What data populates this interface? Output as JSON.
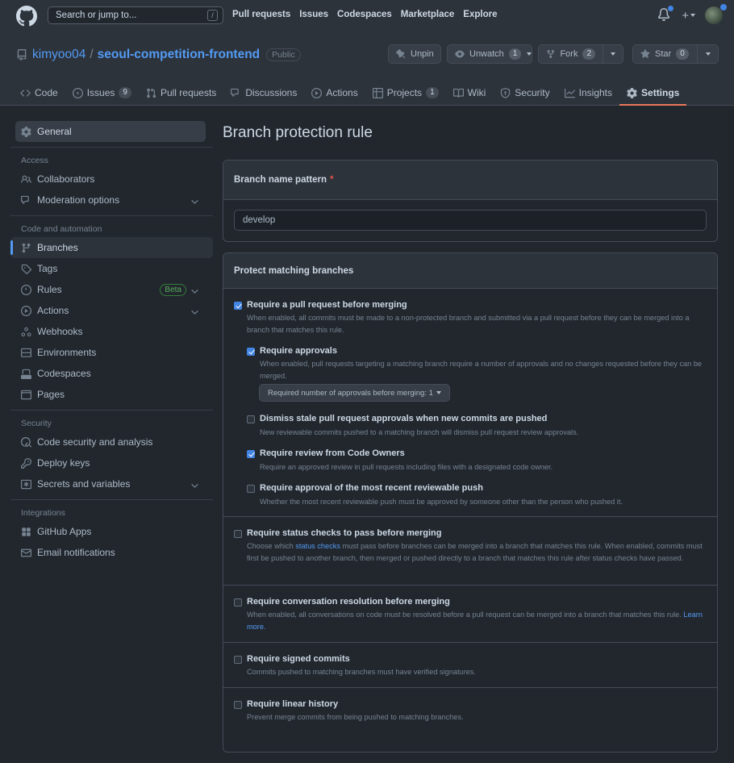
{
  "header": {
    "search_placeholder": "Search or jump to...",
    "search_key": "/",
    "nav": [
      "Pull requests",
      "Issues",
      "Codespaces",
      "Marketplace",
      "Explore"
    ]
  },
  "repo": {
    "owner": "kimyoo04",
    "separator": "/",
    "name": "seoul-competition-frontend",
    "visibility": "Public",
    "unpin_label": "Unpin",
    "unwatch_label": "Unwatch",
    "watch_count": "1",
    "fork_label": "Fork",
    "fork_count": "2",
    "star_label": "Star",
    "star_count": "0"
  },
  "tabs": [
    {
      "label": "Code",
      "icon": "code-icon"
    },
    {
      "label": "Issues",
      "count": "9",
      "icon": "issue-icon"
    },
    {
      "label": "Pull requests",
      "icon": "pull-request-icon"
    },
    {
      "label": "Discussions",
      "icon": "discussion-icon"
    },
    {
      "label": "Actions",
      "icon": "play-icon"
    },
    {
      "label": "Projects",
      "count": "1",
      "icon": "table-icon"
    },
    {
      "label": "Wiki",
      "icon": "book-icon"
    },
    {
      "label": "Security",
      "icon": "shield-icon"
    },
    {
      "label": "Insights",
      "icon": "graph-icon"
    },
    {
      "label": "Settings",
      "icon": "gear-icon",
      "active": true
    }
  ],
  "sidebar": {
    "general": "General",
    "group_access": "Access",
    "collaborators": "Collaborators",
    "moderation": "Moderation options",
    "group_code": "Code and automation",
    "branches": "Branches",
    "tags": "Tags",
    "rules": "Rules",
    "beta": "Beta",
    "actions": "Actions",
    "webhooks": "Webhooks",
    "environments": "Environments",
    "codespaces": "Codespaces",
    "pages": "Pages",
    "group_security": "Security",
    "code_security": "Code security and analysis",
    "deploy_keys": "Deploy keys",
    "secrets": "Secrets and variables",
    "group_integrations": "Integrations",
    "github_apps": "GitHub Apps",
    "email_notifications": "Email notifications"
  },
  "main": {
    "title": "Branch protection rule",
    "pattern_label": "Branch name pattern",
    "required_mark": "*",
    "pattern_value": "develop",
    "protect_header": "Protect matching branches",
    "options": {
      "require_pr": {
        "title": "Require a pull request before merging",
        "desc": "When enabled, all commits must be made to a non-protected branch and submitted via a pull request before they can be merged into a branch that matches this rule.",
        "checked": true
      },
      "require_approvals": {
        "title": "Require approvals",
        "desc": "When enabled, pull requests targeting a matching branch require a number of approvals and no changes requested before they can be merged.",
        "checked": true,
        "select_label": "Required number of approvals before merging: 1"
      },
      "dismiss_stale": {
        "title": "Dismiss stale pull request approvals when new commits are pushed",
        "desc": "New reviewable commits pushed to a matching branch will dismiss pull request review approvals.",
        "checked": false
      },
      "code_owners": {
        "title": "Require review from Code Owners",
        "desc": "Require an approved review in pull requests including files with a designated code owner.",
        "checked": true
      },
      "recent_push": {
        "title": "Require approval of the most recent reviewable push",
        "desc": "Whether the most recent reviewable push must be approved by someone other than the person who pushed it.",
        "checked": false
      },
      "status_checks": {
        "title": "Require status checks to pass before merging",
        "desc_before": "Choose which ",
        "desc_link": "status checks",
        "desc_after": " must pass before branches can be merged into a branch that matches this rule. When enabled, commits must first be pushed to another branch, then merged or pushed directly to a branch that matches this rule after status checks have passed.",
        "checked": false
      },
      "conversation": {
        "title": "Require conversation resolution before merging",
        "desc": "When enabled, all conversations on code must be resolved before a pull request can be merged into a branch that matches this rule.",
        "link": "Learn more.",
        "checked": false
      },
      "signed": {
        "title": "Require signed commits",
        "desc": "Commits pushed to matching branches must have verified signatures.",
        "checked": false
      },
      "linear": {
        "title": "Require linear history",
        "desc": "Prevent merge commits from being pushed to matching branches.",
        "checked": false
      }
    }
  }
}
